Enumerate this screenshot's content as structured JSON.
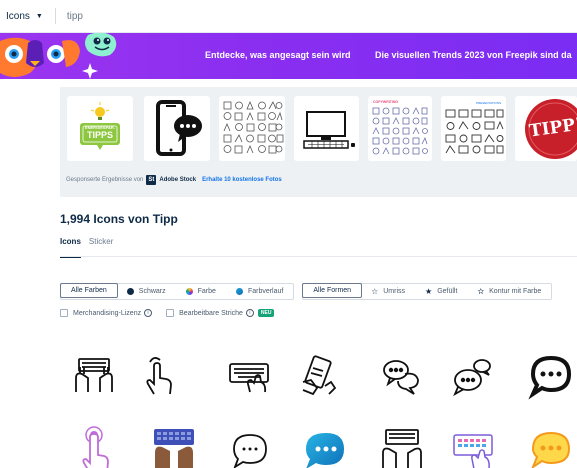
{
  "search": {
    "type_label": "Icons",
    "query": "tipp"
  },
  "banner": {
    "message1": "Entdecke, was angesagt sein wird",
    "message2": "Die visuellen Trends 2023 von Freepik sind da"
  },
  "sponsored": {
    "label": "Gesponserte Ergebnisse von",
    "badge": "St",
    "stock_name": "Adobe Stock",
    "offer_link": "Erhalte 10 kostenlose Fotos",
    "thumbnails": [
      {
        "text_line1": "ENERGIESPAR-",
        "text_line2": "TIPPS"
      },
      {},
      {},
      {},
      {
        "text_line1": "COPYWRITING"
      },
      {
        "text_line1": "PRESENTATIONS"
      },
      {
        "text_line1": "TIPP!"
      }
    ]
  },
  "results": {
    "title": "1,994 Icons von Tipp"
  },
  "tabs": [
    {
      "label": "Icons"
    },
    {
      "label": "Sticker"
    }
  ],
  "color_filters": [
    {
      "label": "Alle Farben",
      "color": ""
    },
    {
      "label": "Schwarz",
      "color": "#0e2a47"
    },
    {
      "label": "Farbe",
      "color": "multicolor"
    },
    {
      "label": "Farbverlauf",
      "color": "#1ba0d8"
    }
  ],
  "shape_filters": [
    {
      "label": "Alle Formen",
      "icon": ""
    },
    {
      "label": "Umriss",
      "icon": "star-outline-icon"
    },
    {
      "label": "Gefüllt",
      "icon": "star-filled-icon"
    },
    {
      "label": "Kontur mit Farbe",
      "icon": "star-outline-color-icon"
    }
  ],
  "checkboxes": [
    {
      "label": "Merchandising-Lizenz"
    },
    {
      "label": "Bearbeitbare Striche",
      "badge": "NEU"
    }
  ],
  "colors": {
    "brand_purple": "#8a2ef0",
    "navy": "#0e2a47",
    "link_blue": "#1273eb",
    "green": "#16a37a",
    "red": "#c8202a"
  }
}
